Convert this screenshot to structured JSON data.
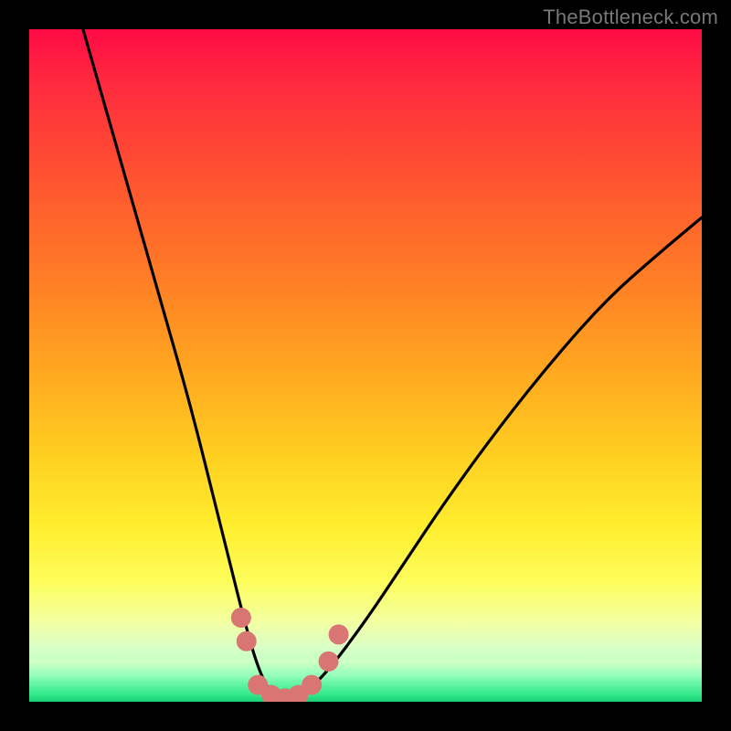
{
  "watermark": "TheBottleneck.com",
  "colors": {
    "background": "#000000",
    "curve": "#000000",
    "beads": "#d97573",
    "gradient_top": "#ff0b44",
    "gradient_mid": "#ffe012",
    "gradient_bottom": "#18cf77"
  },
  "chart_data": {
    "type": "line",
    "title": "",
    "xlabel": "",
    "ylabel": "",
    "xlim": [
      0,
      100
    ],
    "ylim": [
      0,
      100
    ],
    "grid": false,
    "legend": false,
    "series": [
      {
        "name": "bottleneck-curve",
        "x": [
          8,
          12,
          16,
          20,
          24,
          28,
          30,
          32,
          34,
          36,
          38,
          40,
          44,
          50,
          56,
          62,
          70,
          78,
          86,
          94,
          100
        ],
        "y": [
          100,
          86,
          72,
          58,
          44,
          28,
          20,
          12,
          5,
          1,
          0,
          0.5,
          4,
          12,
          21,
          30,
          41,
          51,
          60,
          67,
          72
        ]
      }
    ],
    "markers": [
      {
        "name": "bead-left-upper",
        "x": 31.5,
        "y": 12.5
      },
      {
        "name": "bead-left-lower",
        "x": 32.3,
        "y": 9.0
      },
      {
        "name": "bead-valley-1",
        "x": 34.0,
        "y": 2.5
      },
      {
        "name": "bead-valley-2",
        "x": 36.0,
        "y": 1.0
      },
      {
        "name": "bead-valley-3",
        "x": 38.0,
        "y": 0.5
      },
      {
        "name": "bead-valley-4",
        "x": 40.0,
        "y": 1.0
      },
      {
        "name": "bead-valley-5",
        "x": 42.0,
        "y": 2.5
      },
      {
        "name": "bead-right-lower",
        "x": 44.5,
        "y": 6.0
      },
      {
        "name": "bead-right-upper",
        "x": 46.0,
        "y": 10.0
      }
    ]
  }
}
